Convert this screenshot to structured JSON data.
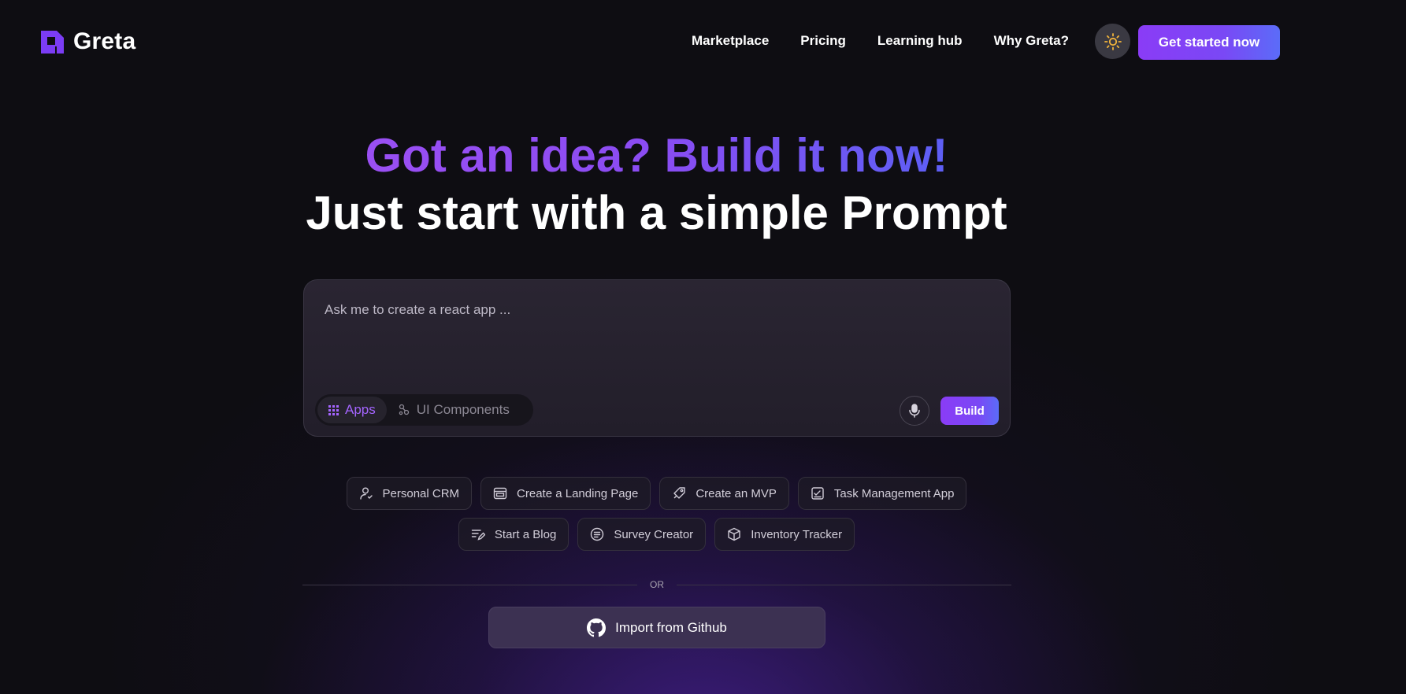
{
  "brand": {
    "name": "Greta"
  },
  "nav": {
    "items": [
      {
        "label": "Marketplace"
      },
      {
        "label": "Pricing"
      },
      {
        "label": "Learning hub"
      },
      {
        "label": "Why Greta?"
      }
    ],
    "theme_icon": "sun-icon",
    "cta_label": "Get started now"
  },
  "hero": {
    "line1": "Got an idea? Build it now!",
    "line2": "Just start with a simple Prompt"
  },
  "prompt": {
    "placeholder": "Ask me to create a react app ...",
    "value": "",
    "modes": [
      {
        "label": "Apps",
        "icon": "grid-icon",
        "active": true
      },
      {
        "label": "UI Components",
        "icon": "components-icon",
        "active": false
      }
    ],
    "mic_icon": "microphone-icon",
    "build_label": "Build"
  },
  "suggestions": {
    "row1": [
      {
        "label": "Personal CRM",
        "icon": "user-icon"
      },
      {
        "label": "Create a Landing Page",
        "icon": "browser-icon"
      },
      {
        "label": "Create an MVP",
        "icon": "rocket-icon"
      },
      {
        "label": "Task Management App",
        "icon": "checklist-icon"
      }
    ],
    "row2": [
      {
        "label": "Start a Blog",
        "icon": "edit-lines-icon"
      },
      {
        "label": "Survey Creator",
        "icon": "survey-icon"
      },
      {
        "label": "Inventory Tracker",
        "icon": "box-icon"
      }
    ]
  },
  "divider": {
    "label": "OR"
  },
  "import": {
    "label": "Import from Github",
    "icon": "github-icon"
  },
  "colors": {
    "background": "#0e0d12",
    "accent": "#8a3cf6",
    "accent_end": "#5b6cf8"
  }
}
